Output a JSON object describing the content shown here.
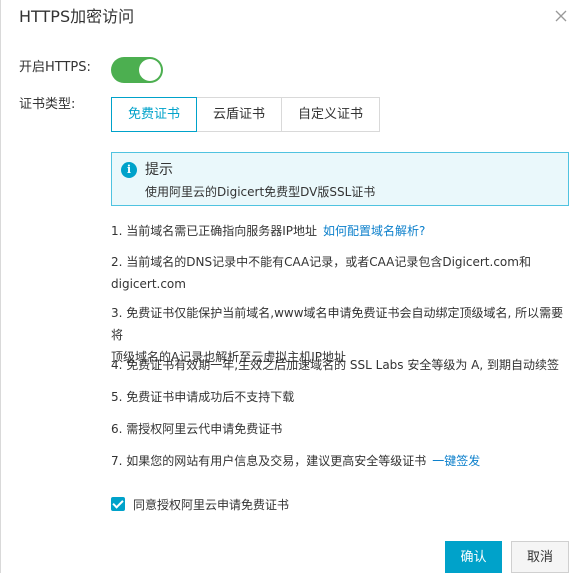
{
  "dialog": {
    "title": "HTTPS加密访问"
  },
  "https": {
    "label": "开启HTTPS:",
    "enabled": true,
    "toggle_color": "#4caf50"
  },
  "cert_type": {
    "label": "证书类型:",
    "tabs": [
      {
        "label": "免费证书",
        "active": true
      },
      {
        "label": "云盾证书",
        "active": false
      },
      {
        "label": "自定义证书",
        "active": false
      }
    ]
  },
  "hint": {
    "icon": "info-icon",
    "title": "提示",
    "text": "使用阿里云的Digicert免费型DV版SSL证书"
  },
  "notes": [
    {
      "text": "1. 当前域名需已正确指向服务器IP地址",
      "link": "如何配置域名解析?"
    },
    {
      "text": "2. 当前域名的DNS记录中不能有CAA记录，或者CAA记录包含Digicert.com和",
      "line2": "digicert.com"
    },
    {
      "text": "3. 免费证书仅能保护当前域名,www域名申请免费证书会自动绑定顶级域名, 所以需要将",
      "line2": "顶级域名的A记录也解析至云虚拟主机IP地址"
    },
    {
      "text": "4. 免费证书有效期一年,生效之后加速域名的 SSL Labs 安全等级为 A, 到期自动续签"
    },
    {
      "text": "5. 免费证书申请成功后不支持下载"
    },
    {
      "text": "6. 需授权阿里云代申请免费证书"
    },
    {
      "text": "7. 如果您的网站有用户信息及交易，建议更高安全等级证书",
      "link": "一键签发"
    }
  ],
  "agree": {
    "checked": true,
    "label": "同意授权阿里云申请免费证书"
  },
  "footer": {
    "ok_label": "确认",
    "cancel_label": "取消"
  },
  "colors": {
    "accent": "#00a2ca",
    "link": "#0b7fcb"
  }
}
